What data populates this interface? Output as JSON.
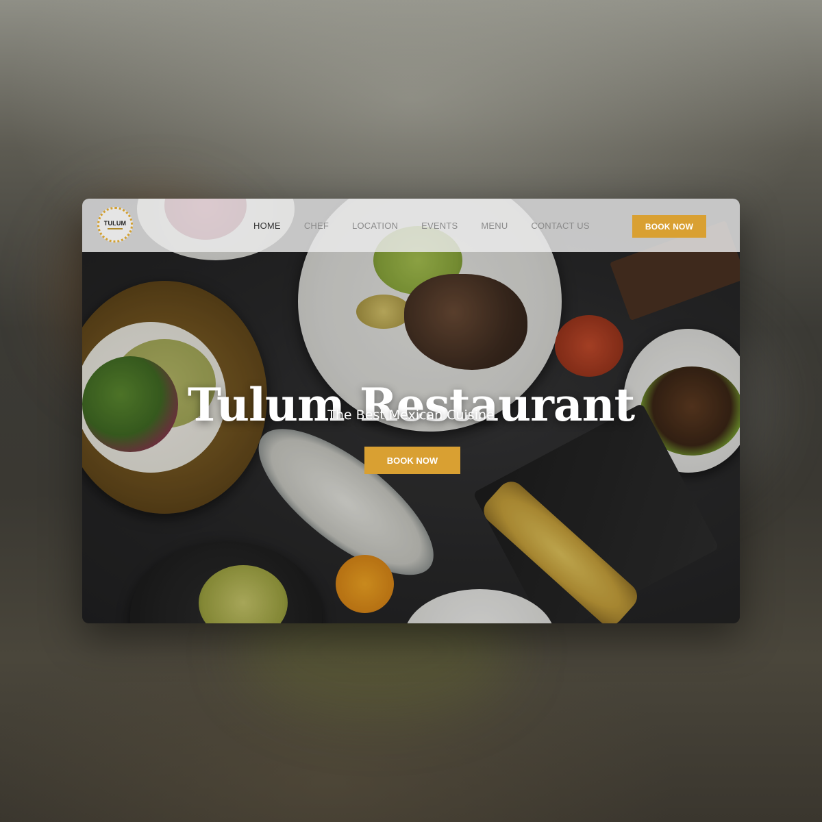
{
  "logo": {
    "text": "TULUM"
  },
  "nav": {
    "items": [
      {
        "label": "HOME",
        "active": true
      },
      {
        "label": "CHEF",
        "active": false
      },
      {
        "label": "LOCATION",
        "active": false
      },
      {
        "label": "EVENTS",
        "active": false
      },
      {
        "label": "MENU",
        "active": false
      },
      {
        "label": "CONTACT US",
        "active": false
      }
    ],
    "book_label": "BOOK NOW"
  },
  "hero": {
    "title": "Tulum Restaurant",
    "subtitle": "The Best Mexican Cuisine",
    "book_label": "BOOK NOW"
  },
  "colors": {
    "accent": "#d9a032",
    "nav_background": "#ececec",
    "nav_text": "#8a8a8a",
    "nav_active_text": "#333333"
  }
}
